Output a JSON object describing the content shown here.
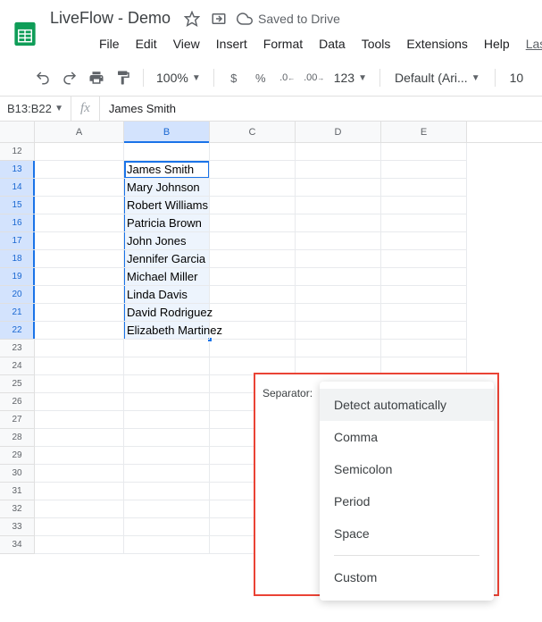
{
  "header": {
    "doc_title": "LiveFlow - Demo",
    "save_status": "Saved to Drive"
  },
  "menu": {
    "items": [
      "File",
      "Edit",
      "View",
      "Insert",
      "Format",
      "Data",
      "Tools",
      "Extensions",
      "Help",
      "Las"
    ]
  },
  "toolbar": {
    "zoom": "100%",
    "currency": "$",
    "percent": "%",
    "format_123": "123",
    "font": "Default (Ari...",
    "font_size": "10"
  },
  "formula_bar": {
    "name_box": "B13:B22",
    "fx": "fx",
    "formula": "James Smith"
  },
  "columns": [
    "A",
    "B",
    "C",
    "D",
    "E"
  ],
  "rows": [
    12,
    13,
    14,
    15,
    16,
    17,
    18,
    19,
    20,
    21,
    22,
    23,
    24,
    25,
    26,
    27,
    28,
    29,
    30,
    31,
    32,
    33,
    34
  ],
  "selected_rows": [
    13,
    14,
    15,
    16,
    17,
    18,
    19,
    20,
    21,
    22
  ],
  "cell_data": {
    "B": [
      "James Smith",
      "Mary Johnson",
      "Robert Williams",
      "Patricia Brown",
      "John Jones",
      "Jennifer Garcia",
      "Michael Miller",
      "Linda Davis",
      "David Rodriguez",
      "Elizabeth Martinez"
    ]
  },
  "separator": {
    "label": "Separator:",
    "options": [
      "Detect automatically",
      "Comma",
      "Semicolon",
      "Period",
      "Space"
    ],
    "custom": "Custom"
  }
}
